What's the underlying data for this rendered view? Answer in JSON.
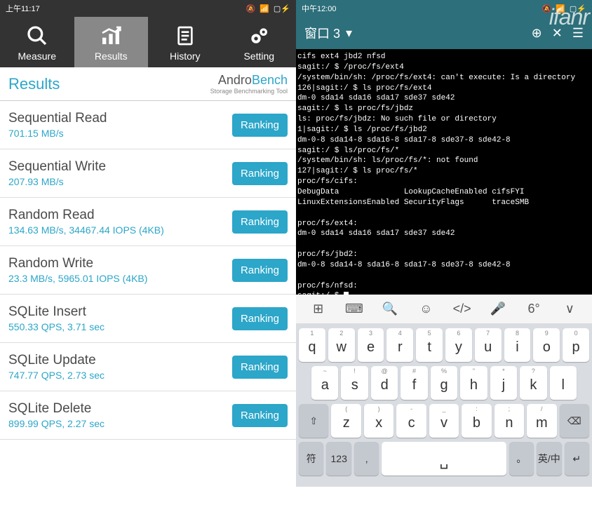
{
  "left": {
    "status": {
      "time": "上午11:17"
    },
    "nav": [
      {
        "label": "Measure"
      },
      {
        "label": "Results",
        "active": true
      },
      {
        "label": "History"
      },
      {
        "label": "Setting"
      }
    ],
    "header": {
      "title": "Results",
      "brand_prefix": "Andro",
      "brand_suffix": "Bench",
      "brand_tagline": "Storage Benchmarking Tool"
    },
    "ranking_label": "Ranking",
    "results": [
      {
        "name": "Sequential Read",
        "value": "701.15 MB/s"
      },
      {
        "name": "Sequential Write",
        "value": "207.93 MB/s"
      },
      {
        "name": "Random Read",
        "value": "134.63 MB/s, 34467.44 IOPS (4KB)"
      },
      {
        "name": "Random Write",
        "value": "23.3 MB/s, 5965.01 IOPS (4KB)"
      },
      {
        "name": "SQLite Insert",
        "value": "550.33 QPS, 3.71 sec"
      },
      {
        "name": "SQLite Update",
        "value": "747.77 QPS, 2.73 sec"
      },
      {
        "name": "SQLite Delete",
        "value": "899.99 QPS, 2.27 sec"
      }
    ]
  },
  "right": {
    "status": {
      "time": "中午12:00"
    },
    "watermark": "ifanr",
    "header": {
      "title": "窗口 3",
      "dropdown": "▾"
    },
    "terminal_text": "cifs ext4 jbd2 nfsd\nsagit:/ $ /proc/fs/ext4\n/system/bin/sh: /proc/fs/ext4: can't execute: Is a directory\n126|sagit:/ $ ls proc/fs/ext4\ndm-0 sda14 sda16 sda17 sde37 sde42\nsagit:/ $ ls proc/fs/jbdz\nls: proc/fs/jbdz: No such file or directory\n1|sagit:/ $ ls /proc/fs/jbd2\ndm-0-8 sda14-8 sda16-8 sda17-8 sde37-8 sde42-8\nsagit:/ $ ls/proc/fs/*\n/system/bin/sh: ls/proc/fs/*: not found\n127|sagit:/ $ ls proc/fs/*\nproc/fs/cifs:\nDebugData              LookupCacheEnabled cifsFYI\nLinuxExtensionsEnabled SecurityFlags      traceSMB\n\nproc/fs/ext4:\ndm-0 sda14 sda16 sda17 sde37 sde42\n\nproc/fs/jbd2:\ndm-0-8 sda14-8 sda16-8 sda17-8 sde37-8 sde42-8\n\nproc/fs/nfsd:\nsagit:/ $ ",
    "keyboard": {
      "toolbar": [
        "⊞",
        "⌨",
        "🔍",
        "☺",
        "</>",
        "🎤",
        "6°",
        "∨"
      ],
      "row1": [
        {
          "sup": "1",
          "main": "q"
        },
        {
          "sup": "2",
          "main": "w"
        },
        {
          "sup": "3",
          "main": "e"
        },
        {
          "sup": "4",
          "main": "r"
        },
        {
          "sup": "5",
          "main": "t"
        },
        {
          "sup": "6",
          "main": "y"
        },
        {
          "sup": "7",
          "main": "u"
        },
        {
          "sup": "8",
          "main": "i"
        },
        {
          "sup": "9",
          "main": "o"
        },
        {
          "sup": "0",
          "main": "p"
        }
      ],
      "row2": [
        {
          "sup": "~",
          "main": "a"
        },
        {
          "sup": "!",
          "main": "s"
        },
        {
          "sup": "@",
          "main": "d"
        },
        {
          "sup": "#",
          "main": "f"
        },
        {
          "sup": "%",
          "main": "g"
        },
        {
          "sup": "\"",
          "main": "h"
        },
        {
          "sup": "*",
          "main": "j"
        },
        {
          "sup": "?",
          "main": "k"
        },
        {
          "sup": "",
          "main": "l"
        }
      ],
      "row3": [
        {
          "main": "⇧",
          "fn": true
        },
        {
          "sup": "(",
          "main": "z"
        },
        {
          "sup": ")",
          "main": "x"
        },
        {
          "sup": "-",
          "main": "c"
        },
        {
          "sup": "_",
          "main": "v"
        },
        {
          "sup": ":",
          "main": "b"
        },
        {
          "sup": ";",
          "main": "n"
        },
        {
          "sup": "/",
          "main": "m"
        },
        {
          "main": "⌫",
          "fn": true
        }
      ],
      "row4": [
        {
          "main": "符",
          "fn": true
        },
        {
          "main": "123",
          "fn": true
        },
        {
          "main": ",",
          "fn": true
        },
        {
          "main": "␣",
          "space": true
        },
        {
          "main": "。",
          "fn": true
        },
        {
          "main": "英/中",
          "fn": true
        },
        {
          "main": "↵",
          "fn": true
        }
      ]
    }
  }
}
